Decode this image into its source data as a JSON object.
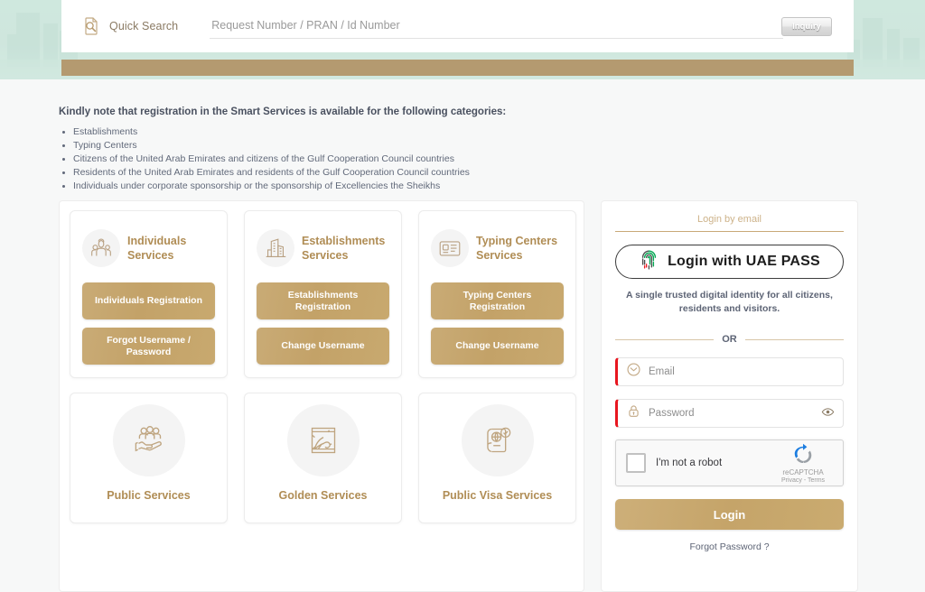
{
  "colors": {
    "banner_teal": "#cfe8de",
    "gold_bar": "#b49a70",
    "gold_accent": "#c3a268",
    "gold_text": "#b08d55",
    "required_red": "#e8161f",
    "text_slate": "#5d6475"
  },
  "header": {
    "quick_search_label": "Quick Search",
    "search_placeholder": "Request Number / PRAN / Id Number",
    "search_value": "",
    "inquiry_label": "Inquiry",
    "quick_search_icon": "document-search-icon"
  },
  "notice": {
    "title": "Kindly note that registration in the Smart Services is available for the following categories:",
    "items": [
      "Establishments",
      "Typing Centers",
      "Citizens of the United Arab Emirates and citizens of the Gulf Cooperation Council countries",
      "Residents of the United Arab Emirates and residents of the Gulf Cooperation Council countries",
      "Individuals under corporate sponsorship or the sponsorship of Excellencies the Sheikhs"
    ]
  },
  "services": {
    "cards": [
      {
        "title": "Individuals Services",
        "icon": "individuals-icon",
        "buttons": [
          "Individuals Registration",
          "Forgot Username / Password"
        ]
      },
      {
        "title": "Establishments Services",
        "icon": "establishments-icon",
        "buttons": [
          "Establishments Registration",
          "Change Username"
        ]
      },
      {
        "title": "Typing Centers Services",
        "icon": "typing-centers-icon",
        "buttons": [
          "Typing Centers Registration",
          "Change Username"
        ]
      }
    ],
    "cards_secondary": [
      {
        "label": "Public Services",
        "icon": "public-services-icon"
      },
      {
        "label": "Golden Services",
        "icon": "golden-services-icon"
      },
      {
        "label": "Public Visa Services",
        "icon": "public-visa-services-icon"
      }
    ]
  },
  "login": {
    "tab_label": "Login by email",
    "uaepass_button": "Login with UAE PASS",
    "uaepass_icon": "fingerprint-icon",
    "uaepass_subtitle": "A single trusted digital identity for all citizens, residents and visitors.",
    "or_label": "OR",
    "email_placeholder": "Email",
    "email_value": "",
    "email_icon": "envelope-icon",
    "password_placeholder": "Password",
    "password_value": "",
    "password_icon": "lock-icon",
    "password_toggle_icon": "eye-icon",
    "recaptcha": {
      "label": "I'm not a robot",
      "brand": "reCAPTCHA",
      "links": "Privacy - Terms",
      "checked": false
    },
    "login_button": "Login",
    "forgot_password": "Forgot Password ?"
  }
}
